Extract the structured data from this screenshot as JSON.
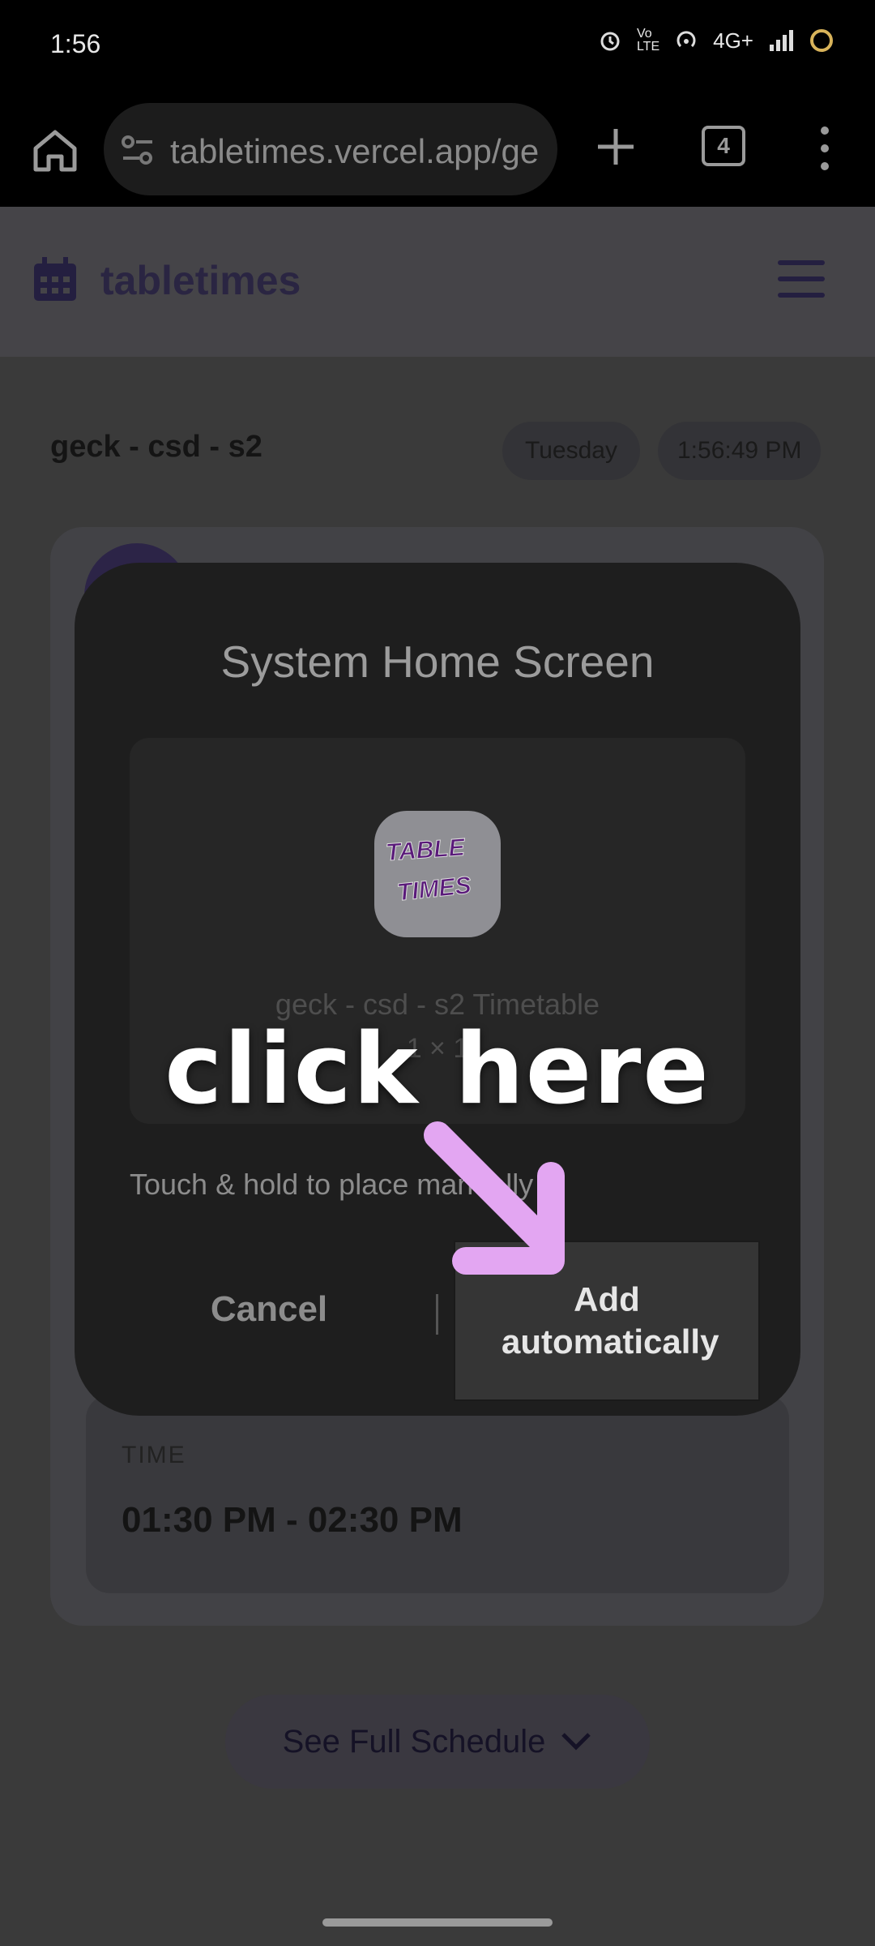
{
  "status_bar": {
    "time": "1:56",
    "network": "4G+"
  },
  "browser": {
    "url": "tabletimes.vercel.app/ge",
    "tab_count": "4"
  },
  "app": {
    "title": "tabletimes"
  },
  "page": {
    "title": "geck - csd - s2",
    "day": "Tuesday",
    "clock": "1:56:49 PM",
    "time_label": "TIME",
    "time_value": "01:30 PM - 02:30 PM",
    "schedule_button": "See Full Schedule"
  },
  "dialog": {
    "title": "System Home Screen",
    "icon_text_1": "TABLE",
    "icon_text_2": "TIMES",
    "widget_name": "geck - csd - s2 Timetable",
    "widget_size": "1 × 1",
    "hint": "Touch & hold to place manually",
    "cancel_label": "Cancel",
    "add_label": "Add automatically"
  },
  "annotation": {
    "text": "click here",
    "arrow_color": "#e3a6f2"
  }
}
